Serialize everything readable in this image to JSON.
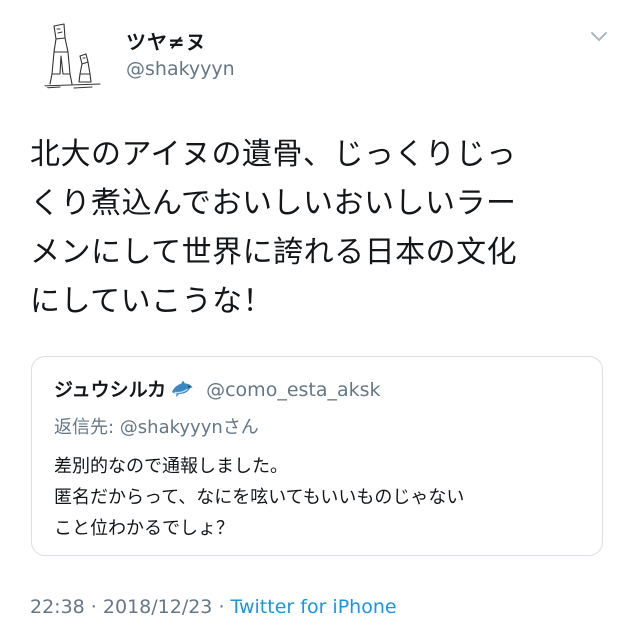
{
  "header": {
    "display_name": "ツヤ≠ヌ",
    "handle": "@shakyyyn",
    "avatar_icon": "sketch-avatar-icon",
    "menu_icon": "chevron-down-icon"
  },
  "tweet": {
    "lines": [
      "北大のアイヌの遺骨、じっくりじっ",
      "くり煮込んでおいしいおいしいラー",
      "メンにして世界に誇れる日本の文化",
      "にしていこうな！"
    ]
  },
  "quote": {
    "name": "ジュウシルカ",
    "emoji_icon": "dolphin-icon",
    "handle": "@como_esta_aksk",
    "reply_prefix": "返信先: ",
    "reply_mention": "@shakyyyn",
    "reply_suffix": "さん",
    "body_lines": [
      "差別的なので通報しました。",
      "匿名だからって、なにを呟いてもいいものじゃない",
      "こと位わかるでしょ？"
    ]
  },
  "meta": {
    "time": "22:38",
    "separator": " · ",
    "date": "2018/12/23",
    "separator2": " · ",
    "source": "Twitter for iPhone"
  },
  "colors": {
    "text": "#14171a",
    "secondary": "#657786",
    "link": "#1b95e0",
    "border": "#d9dfe4"
  }
}
